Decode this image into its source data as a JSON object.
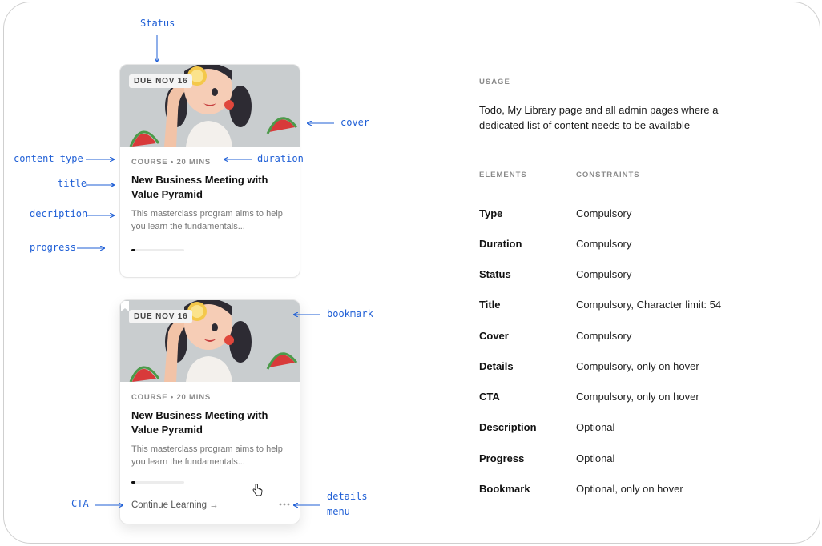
{
  "colors": {
    "annotation": "#1f5fd6",
    "progress": "#111111",
    "cover_bg": "#c9cdcf"
  },
  "cards": [
    {
      "status": "DUE NOV 16",
      "meta": "COURSE • 20 MINS",
      "title": "New Business Meeting with Value Pyramid",
      "description": "This masterclass program aims to help you learn the fundamentals...",
      "progress": 0.08
    },
    {
      "status": "DUE NOV 16",
      "meta": "COURSE • 20 MINS",
      "title": "New Business Meeting with Value Pyramid",
      "description": "This masterclass program aims to help you learn the fundamentals...",
      "progress": 0.08,
      "cta": "Continue Learning →",
      "bookmark_icon": "bookmark-icon",
      "details_icon": "more-horizontal-icon"
    }
  ],
  "annotations": {
    "status": "Status",
    "cover": "cover",
    "content_type": "content type",
    "duration": "duration",
    "title": "title",
    "description": "decription",
    "progress": "progress",
    "bookmark": "bookmark",
    "cta": "CTA",
    "details_line1": "details",
    "details_line2": "menu"
  },
  "usage": {
    "heading": "USAGE",
    "text": "Todo, My Library page and all admin pages where a dedicated list of content needs to be available"
  },
  "table": {
    "col_elements": "ELEMENTS",
    "col_constraints": "CONSTRAINTS",
    "rows": [
      {
        "element": "Type",
        "constraint": "Compulsory"
      },
      {
        "element": "Duration",
        "constraint": "Compulsory"
      },
      {
        "element": "Status",
        "constraint": "Compulsory"
      },
      {
        "element": "Title",
        "constraint": "Compulsory, Character limit: 54"
      },
      {
        "element": "Cover",
        "constraint": "Compulsory"
      },
      {
        "element": "Details",
        "constraint": "Compulsory, only on hover"
      },
      {
        "element": "CTA",
        "constraint": "Compulsory, only on hover"
      },
      {
        "element": "Description",
        "constraint": "Optional"
      },
      {
        "element": "Progress",
        "constraint": "Optional"
      },
      {
        "element": "Bookmark",
        "constraint": "Optional, only on hover"
      }
    ]
  }
}
